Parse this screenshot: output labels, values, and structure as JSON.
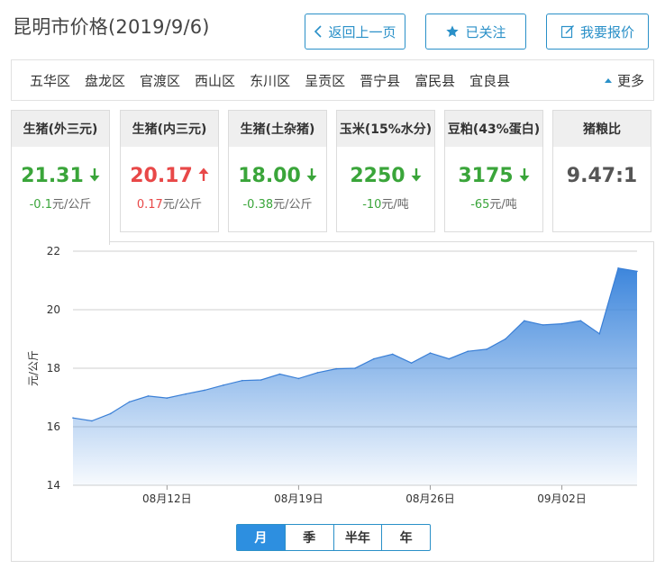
{
  "page": {
    "title": "昆明市价格(2019/9/6)"
  },
  "toolbar": {
    "back_label": "返回上一页",
    "follow_label": "已关注",
    "report_label": "我要报价"
  },
  "regions": {
    "items": [
      "五华区",
      "盘龙区",
      "官渡区",
      "西山区",
      "东川区",
      "呈贡区",
      "晋宁县",
      "富民县",
      "宜良县"
    ],
    "more_label": "更多"
  },
  "cards": [
    {
      "name": "生猪(外三元)",
      "price": "21.31",
      "trend": "down",
      "change_num": "-0.1",
      "change_unit": "元/公斤",
      "color": "#3aa53a"
    },
    {
      "name": "生猪(内三元)",
      "price": "20.17",
      "trend": "up",
      "change_num": "0.17",
      "change_unit": "元/公斤",
      "color": "#e84848"
    },
    {
      "name": "生猪(土杂猪)",
      "price": "18.00",
      "trend": "down",
      "change_num": "-0.38",
      "change_unit": "元/公斤",
      "color": "#3aa53a"
    },
    {
      "name": "玉米(15%水分)",
      "price": "2250",
      "trend": "down",
      "change_num": "-10",
      "change_unit": "元/吨",
      "color": "#3aa53a"
    },
    {
      "name": "豆粕(43%蛋白)",
      "price": "3175",
      "trend": "down",
      "change_num": "-65",
      "change_unit": "元/吨",
      "color": "#3aa53a"
    },
    {
      "name": "猪粮比",
      "price": "9.47:1",
      "trend": "none",
      "change_num": "",
      "change_unit": "",
      "color": "#555555"
    }
  ],
  "range_tabs": {
    "month": "月",
    "quarter": "季",
    "half_year": "半年",
    "year": "年",
    "selected": "月"
  },
  "chart_data": {
    "type": "area",
    "ylabel": "元/公斤",
    "ylim": [
      14,
      22
    ],
    "yticks": [
      "14",
      "16",
      "18",
      "20",
      "22"
    ],
    "xtick_labels": [
      "08月12日",
      "08月19日",
      "08月26日",
      "09月02日"
    ],
    "xtick_index": [
      5,
      12,
      19,
      26
    ],
    "x": [
      "08月07日",
      "08月08日",
      "08月09日",
      "08月10日",
      "08月11日",
      "08月12日",
      "08月13日",
      "08月14日",
      "08月15日",
      "08月16日",
      "08月17日",
      "08月18日",
      "08月19日",
      "08月20日",
      "08月21日",
      "08月22日",
      "08月23日",
      "08月24日",
      "08月25日",
      "08月26日",
      "08月27日",
      "08月28日",
      "08月29日",
      "08月30日",
      "08月31日",
      "09月01日",
      "09月02日",
      "09月03日",
      "09月04日",
      "09月05日",
      "09月06日"
    ],
    "series": [
      {
        "values": [
          16.3,
          16.2,
          16.45,
          16.85,
          17.05,
          16.98,
          17.12,
          17.25,
          17.42,
          17.58,
          17.6,
          17.8,
          17.65,
          17.85,
          17.98,
          18.0,
          18.32,
          18.48,
          18.18,
          18.52,
          18.32,
          18.58,
          18.65,
          19.0,
          19.62,
          19.48,
          19.52,
          19.62,
          19.18,
          21.42,
          21.31
        ]
      }
    ],
    "colors": {
      "line": "#3a7fd6",
      "fill_top": "#3d86dc",
      "fill_bottom": "#ffffff"
    },
    "grid": true
  }
}
